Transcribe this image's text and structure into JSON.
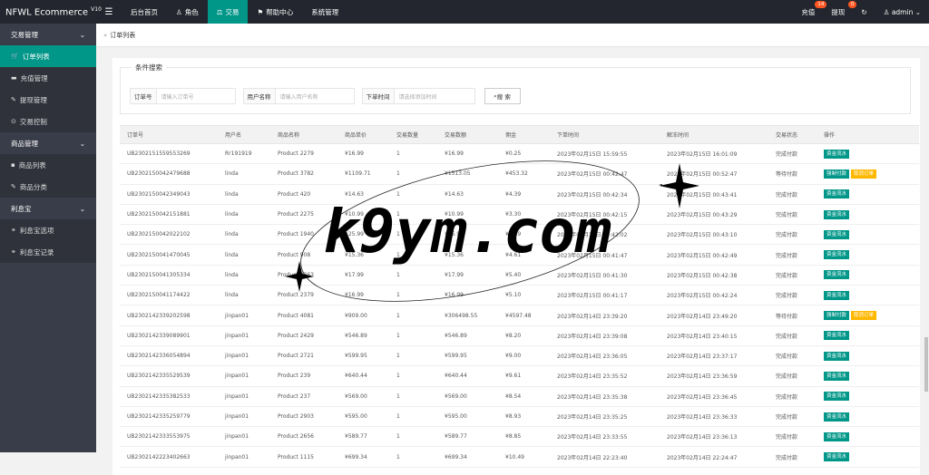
{
  "app": {
    "title": "NFWL Ecommerce",
    "version": "V10"
  },
  "nav": [
    {
      "label": "后台首页",
      "icon": "home-icon",
      "glyph": ""
    },
    {
      "label": "角色",
      "icon": "user-icon",
      "glyph": "♙"
    },
    {
      "label": "交易",
      "icon": "scale-icon",
      "glyph": "⚖"
    },
    {
      "label": "帮助中心",
      "icon": "flag-icon",
      "glyph": "⚑"
    },
    {
      "label": "系统管理",
      "icon": "",
      "glyph": ""
    }
  ],
  "topright": {
    "recharge": "充值",
    "recharge_badge": "14",
    "withdraw": "提现",
    "withdraw_badge": "0",
    "refresh": "↻",
    "user": "admin"
  },
  "sidebar": {
    "groups": [
      {
        "label": "交易管理",
        "items": [
          {
            "label": "订单列表",
            "glyph": "🛒"
          },
          {
            "label": "充值管理",
            "glyph": "▬"
          },
          {
            "label": "提现管理",
            "glyph": "✎"
          },
          {
            "label": "交易控制",
            "glyph": "⊙"
          }
        ]
      },
      {
        "label": "商品管理",
        "items": [
          {
            "label": "商品列表",
            "glyph": "▪"
          },
          {
            "label": "商品分类",
            "glyph": "✎"
          }
        ]
      },
      {
        "label": "利息宝",
        "items": [
          {
            "label": "利息宝选项",
            "glyph": "⚭"
          },
          {
            "label": "利息宝记录",
            "glyph": "⚭"
          }
        ]
      }
    ]
  },
  "breadcrumb": "订单列表",
  "search": {
    "legend": "条件搜索",
    "order_label": "订单号",
    "order_placeholder": "请输入订单号",
    "user_label": "用户名称",
    "user_placeholder": "请输入用户名称",
    "time_label": "下单时间",
    "time_placeholder": "请选择添加时间",
    "button": "搜 索"
  },
  "table": {
    "headers": [
      "订单号",
      "用户名",
      "商品名称",
      "商品单价",
      "交易数量",
      "交易数额",
      "佣金",
      "下单时间",
      "解冻时间",
      "交易状态",
      "操作"
    ],
    "rows": [
      [
        "UB2302151559553269",
        "Rr191919",
        "Product 2279",
        "¥16.99",
        "1",
        "¥16.99",
        "¥0.25",
        "2023年02月15日 15:59:55",
        "2023年02月15日 16:01:09",
        "完成付款",
        "资金流水",
        ""
      ],
      [
        "UB2302150042479688",
        "linda",
        "Product 3782",
        "¥1109.71",
        "1",
        "¥1513.05",
        "¥453.32",
        "2023年02月15日 00:42:47",
        "2023年02月15日 00:52:47",
        "等待付款",
        "强制付款",
        "取消订单"
      ],
      [
        "UB2302150042349043",
        "linda",
        "Product 420",
        "¥14.63",
        "1",
        "¥14.63",
        "¥4.39",
        "2023年02月15日 00:42:34",
        "2023年02月15日 00:43:41",
        "完成付款",
        "资金流水",
        ""
      ],
      [
        "UB2302150042151881",
        "linda",
        "Product 2275",
        "¥10.99",
        "1",
        "¥10.99",
        "¥3.30",
        "2023年02月15日 00:42:15",
        "2023年02月15日 00:43:29",
        "完成付款",
        "资金流水",
        ""
      ],
      [
        "UB2302150042022102",
        "linda",
        "Product 1940",
        "¥25.99",
        "1",
        "¥25.99",
        "¥2.89",
        "2023年02月15日 00:42:02",
        "2023年02月15日 00:43:10",
        "完成付款",
        "资金流水",
        ""
      ],
      [
        "UB2302150041470045",
        "linda",
        "Product 908",
        "¥15.36",
        "1",
        "¥15.36",
        "¥4.61",
        "2023年02月15日 00:41:47",
        "2023年02月15日 00:42:49",
        "完成付款",
        "资金流水",
        ""
      ],
      [
        "UB2302150041305334",
        "linda",
        "Product 2363",
        "¥17.99",
        "1",
        "¥17.99",
        "¥5.40",
        "2023年02月15日 00:41:30",
        "2023年02月15日 00:42:38",
        "完成付款",
        "资金流水",
        ""
      ],
      [
        "UB2302150041174422",
        "linda",
        "Product 2379",
        "¥16.99",
        "1",
        "¥16.99",
        "¥5.10",
        "2023年02月15日 00:41:17",
        "2023年02月15日 00:42:24",
        "完成付款",
        "资金流水",
        ""
      ],
      [
        "UB2302142339202598",
        "jinpan01",
        "Product 4081",
        "¥909.00",
        "1",
        "¥306498.55",
        "¥4597.48",
        "2023年02月14日 23:39:20",
        "2023年02月14日 23:49:20",
        "等待付款",
        "强制付款",
        "取消订单"
      ],
      [
        "UB2302142339089901",
        "jinpan01",
        "Product 2429",
        "¥546.89",
        "1",
        "¥546.89",
        "¥8.20",
        "2023年02月14日 23:39:08",
        "2023年02月14日 23:40:15",
        "完成付款",
        "资金流水",
        ""
      ],
      [
        "UB2302142336054894",
        "jinpan01",
        "Product 2721",
        "¥599.95",
        "1",
        "¥599.95",
        "¥9.00",
        "2023年02月14日 23:36:05",
        "2023年02月14日 23:37:17",
        "完成付款",
        "资金流水",
        ""
      ],
      [
        "UB2302142335529539",
        "jinpan01",
        "Product 239",
        "¥640.44",
        "1",
        "¥640.44",
        "¥9.61",
        "2023年02月14日 23:35:52",
        "2023年02月14日 23:36:59",
        "完成付款",
        "资金流水",
        ""
      ],
      [
        "UB2302142335382533",
        "jinpan01",
        "Product 237",
        "¥569.00",
        "1",
        "¥569.00",
        "¥8.54",
        "2023年02月14日 23:35:38",
        "2023年02月14日 23:36:45",
        "完成付款",
        "资金流水",
        ""
      ],
      [
        "UB2302142335259779",
        "jinpan01",
        "Product 2903",
        "¥595.00",
        "1",
        "¥595.00",
        "¥8.93",
        "2023年02月14日 23:35:25",
        "2023年02月14日 23:36:33",
        "完成付款",
        "资金流水",
        ""
      ],
      [
        "UB2302142333553975",
        "jinpan01",
        "Product 2656",
        "¥589.77",
        "1",
        "¥589.77",
        "¥8.85",
        "2023年02月14日 23:33:55",
        "2023年02月14日 23:36:13",
        "完成付款",
        "资金流水",
        ""
      ],
      [
        "UB2302142223402663",
        "jinpan01",
        "Product 1115",
        "¥699.34",
        "1",
        "¥699.34",
        "¥10.49",
        "2023年02月14日 22:23:40",
        "2023年02月14日 22:24:47",
        "完成付款",
        "资金流水",
        ""
      ]
    ]
  },
  "watermark": "k9ym.com"
}
